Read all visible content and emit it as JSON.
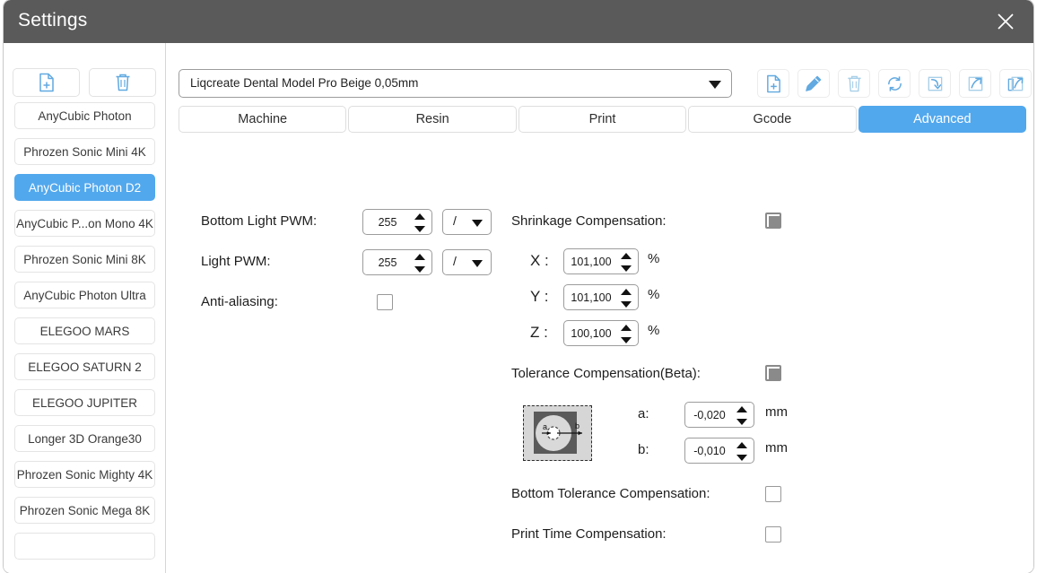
{
  "window": {
    "title": "Settings",
    "close_icon": "close-icon"
  },
  "colors": {
    "titlebar_bg": "#5a5a5a",
    "accent_blue": "#52a8ed",
    "icon_blue": "#61a9e0",
    "checkbox_fill": "#8a8a8a"
  },
  "sidebar": {
    "toolbar": [
      {
        "name": "add-printer-button",
        "icon": "file-plus-icon"
      },
      {
        "name": "delete-printer-button",
        "icon": "trash-icon"
      }
    ],
    "printers": [
      {
        "label": "AnyCubic Photon",
        "selected": false
      },
      {
        "label": "Phrozen Sonic Mini 4K",
        "selected": false
      },
      {
        "label": "AnyCubic Photon D2",
        "selected": true
      },
      {
        "label": "AnyCubic P...on Mono 4K",
        "selected": false
      },
      {
        "label": "Phrozen Sonic Mini 8K",
        "selected": false
      },
      {
        "label": "AnyCubic Photon Ultra",
        "selected": false
      },
      {
        "label": "ELEGOO MARS",
        "selected": false
      },
      {
        "label": "ELEGOO SATURN 2",
        "selected": false
      },
      {
        "label": "ELEGOO JUPITER",
        "selected": false
      },
      {
        "label": "Longer 3D Orange30",
        "selected": false
      },
      {
        "label": "Phrozen Sonic Mighty 4K",
        "selected": false
      },
      {
        "label": "Phrozen Sonic Mega 8K",
        "selected": false
      },
      {
        "label": "",
        "selected": false
      }
    ]
  },
  "profile": {
    "selected": "Liqcreate Dental Model Pro Beige 0,05mm",
    "dropdown_icon": "chevron-down-icon",
    "tools": [
      {
        "name": "new-profile-button",
        "icon": "file-plus-icon"
      },
      {
        "name": "edit-profile-button",
        "icon": "pencil-icon"
      },
      {
        "name": "delete-profile-button",
        "icon": "trash-icon"
      },
      {
        "name": "refresh-profile-button",
        "icon": "refresh-icon"
      },
      {
        "name": "import-profile-button",
        "icon": "import-arrow-icon"
      },
      {
        "name": "export-profile-button",
        "icon": "export-arrow-icon"
      },
      {
        "name": "share-profile-button",
        "icon": "share-copy-icon"
      }
    ]
  },
  "tabs": [
    {
      "label": "Machine",
      "active": false
    },
    {
      "label": "Resin",
      "active": false
    },
    {
      "label": "Print",
      "active": false
    },
    {
      "label": "Gcode",
      "active": false
    },
    {
      "label": "Advanced",
      "active": true
    }
  ],
  "advanced": {
    "bottom_light_pwm": {
      "label": "Bottom Light PWM:",
      "value": "255",
      "unit": "/"
    },
    "light_pwm": {
      "label": "Light PWM:",
      "value": "255",
      "unit": "/"
    },
    "anti_aliasing": {
      "label": "Anti-aliasing:",
      "checked": false
    },
    "shrinkage": {
      "label": "Shrinkage Compensation:",
      "state": "filled",
      "axes": [
        {
          "axis": "X :",
          "value": "101,100",
          "unit": "%"
        },
        {
          "axis": "Y :",
          "value": "101,100",
          "unit": "%"
        },
        {
          "axis": "Z :",
          "value": "100,100",
          "unit": "%"
        }
      ]
    },
    "tolerance": {
      "label": "Tolerance Compensation(Beta):",
      "state": "filled",
      "diagram_icon": "tolerance-diagram-icon",
      "diagram_labels": {
        "a": "a",
        "b": "b"
      },
      "fields": [
        {
          "label": "a:",
          "value": "-0,020",
          "unit": "mm"
        },
        {
          "label": "b:",
          "value": "-0,010",
          "unit": "mm"
        }
      ]
    },
    "bottom_tolerance": {
      "label": "Bottom Tolerance Compensation:",
      "checked": false
    },
    "print_time": {
      "label": "Print Time Compensation:",
      "checked": false
    }
  }
}
